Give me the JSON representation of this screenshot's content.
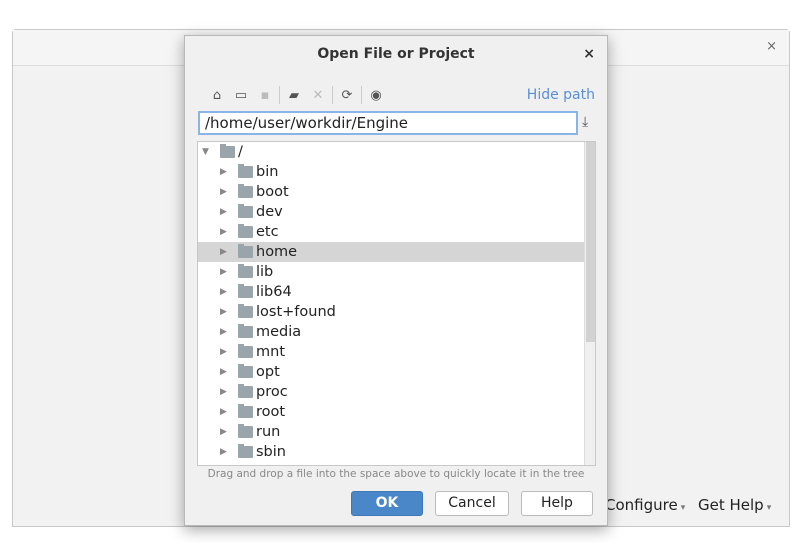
{
  "background": {
    "close": "×",
    "configure": "Configure",
    "get_help": "Get Help",
    "caret": "▾"
  },
  "dialog": {
    "title": "Open File or Project",
    "close": "×",
    "toolbar": [
      {
        "icon": "home-icon",
        "glyph": "⌂",
        "enabled": true
      },
      {
        "icon": "desktop-icon",
        "glyph": "▭",
        "enabled": true
      },
      {
        "icon": "project-folder-icon",
        "glyph": "▪",
        "enabled": false
      },
      {
        "sep": true
      },
      {
        "icon": "new-folder-icon",
        "glyph": "▰",
        "enabled": true
      },
      {
        "icon": "delete-icon",
        "glyph": "✕",
        "enabled": false
      },
      {
        "sep": true
      },
      {
        "icon": "refresh-icon",
        "glyph": "⟳",
        "enabled": true
      },
      {
        "sep": true
      },
      {
        "icon": "show-hidden-icon",
        "glyph": "◉",
        "enabled": true
      }
    ],
    "hide_path": "Hide path",
    "path_value": "/home/user/workdir/Engine",
    "download_glyph": "⤓",
    "tree": {
      "root": "/",
      "items": [
        "bin",
        "boot",
        "dev",
        "etc",
        "home",
        "lib",
        "lib64",
        "lost+found",
        "media",
        "mnt",
        "opt",
        "proc",
        "root",
        "run",
        "sbin"
      ],
      "selected": "home"
    },
    "hint": "Drag and drop a file into the space above to quickly locate it in the tree",
    "buttons": {
      "ok": "OK",
      "cancel": "Cancel",
      "help": "Help"
    }
  }
}
